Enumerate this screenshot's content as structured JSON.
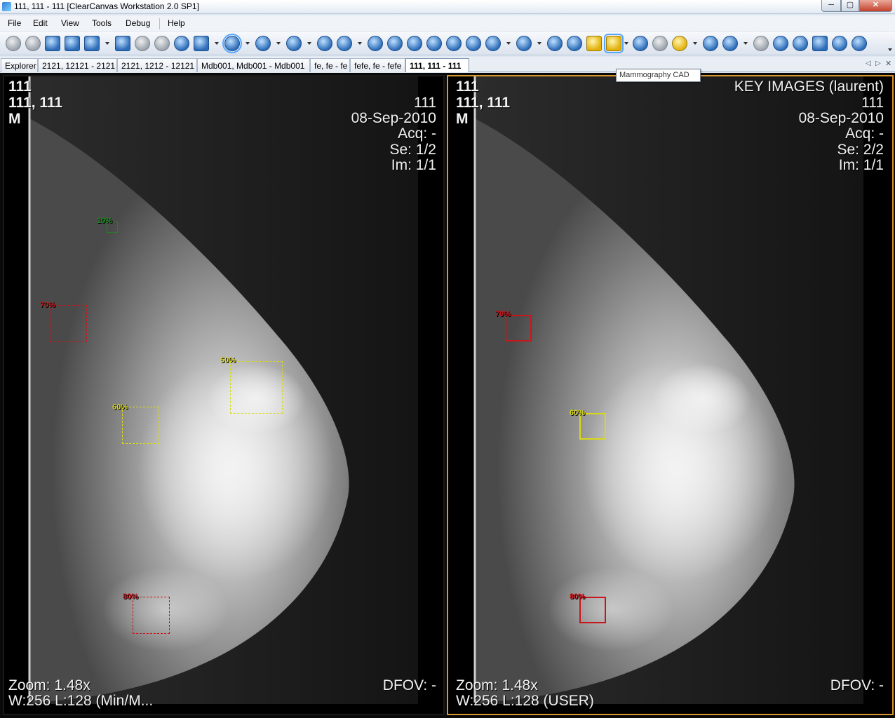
{
  "window": {
    "title": "111, 111 - 111 [ClearCanvas Workstation 2.0 SP1]",
    "minimize_glyph": "─",
    "maximize_glyph": "▢",
    "close_glyph": "✕"
  },
  "menu": {
    "file": "File",
    "edit": "Edit",
    "view": "View",
    "tools": "Tools",
    "debug": "Debug",
    "help": "Help"
  },
  "tabs": [
    {
      "label": "Explorer"
    },
    {
      "label": "2121, 12121 - 2121"
    },
    {
      "label": "2121, 1212 - 12121"
    },
    {
      "label": "Mdb001, Mdb001 - Mdb001"
    },
    {
      "label": "fe, fe - fe"
    },
    {
      "label": "fefe, fe - fefe"
    },
    {
      "label": "111, 111 - 111"
    }
  ],
  "tab_nav": {
    "prev": "◁",
    "next": "▷",
    "close": "✕"
  },
  "tooltip": "Mammography CAD",
  "left_pane": {
    "patient_id": "111",
    "patient_name": "111, 111",
    "sex": "M",
    "accession": "111",
    "date": "08-Sep-2010",
    "acq": "Acq: -",
    "series": "Se: 1/2",
    "image": "Im: 1/1",
    "zoom": "Zoom: 1.48x",
    "window_level": "W:256 L:128  (Min/M...",
    "dfov": "DFOV: -",
    "cad_marks": [
      {
        "label": "10%",
        "color": "#1f8a1f"
      },
      {
        "label": "70%",
        "color": "#c8161b"
      },
      {
        "label": "50%",
        "color": "#d8d818"
      },
      {
        "label": "60%",
        "color": "#d8d818"
      },
      {
        "label": "80%",
        "color": "#c8161b"
      }
    ]
  },
  "right_pane": {
    "patient_id": "111",
    "patient_name": "111, 111",
    "sex": "M",
    "series_description": "KEY IMAGES (laurent)",
    "accession": "111",
    "date": "08-Sep-2010",
    "acq": "Acq: -",
    "series": "Se: 2/2",
    "image": "Im: 1/1",
    "zoom": "Zoom: 1.48x",
    "window_level": "W:256 L:128 (USER)",
    "dfov": "DFOV: -",
    "cad_marks": [
      {
        "label": "70%",
        "color": "#c8161b"
      },
      {
        "label": "60%",
        "color": "#d8d818"
      },
      {
        "label": "80%",
        "color": "#c8161b"
      }
    ]
  },
  "colors": {
    "active_pane_border": "#d8962c",
    "cad_red": "#c8161b",
    "cad_yellow": "#d8d818",
    "cad_green": "#1f8a1f"
  },
  "toolbar_icons": [
    "undo-icon",
    "redo-icon",
    "clipboard-icon",
    "layout-icon",
    "tile-icon",
    "stack-icon",
    "window-level-icon",
    "key-image-icon",
    "key-image-add-icon",
    "cine-icon",
    "copy-icon",
    "cad-icon",
    "zoom-icon",
    "magnify-icon",
    "pan-icon",
    "probe-icon",
    "info-icon",
    "flip-horizontal-icon",
    "flip-vertical-icon",
    "rotate-left-icon",
    "rotate-right-icon",
    "invert-icon",
    "reset-icon",
    "print-icon",
    "stop-icon",
    "previous-icon",
    "next-icon",
    "sync-icon",
    "mammography-cad-icon",
    "link-icon",
    "binoculars-icon",
    "light-icon",
    "angle-icon",
    "ruler-icon",
    "crosshair-icon",
    "measure-1-icon",
    "measure-2-icon",
    "measure-3-icon",
    "measure-4-icon",
    "measure-5-icon"
  ]
}
